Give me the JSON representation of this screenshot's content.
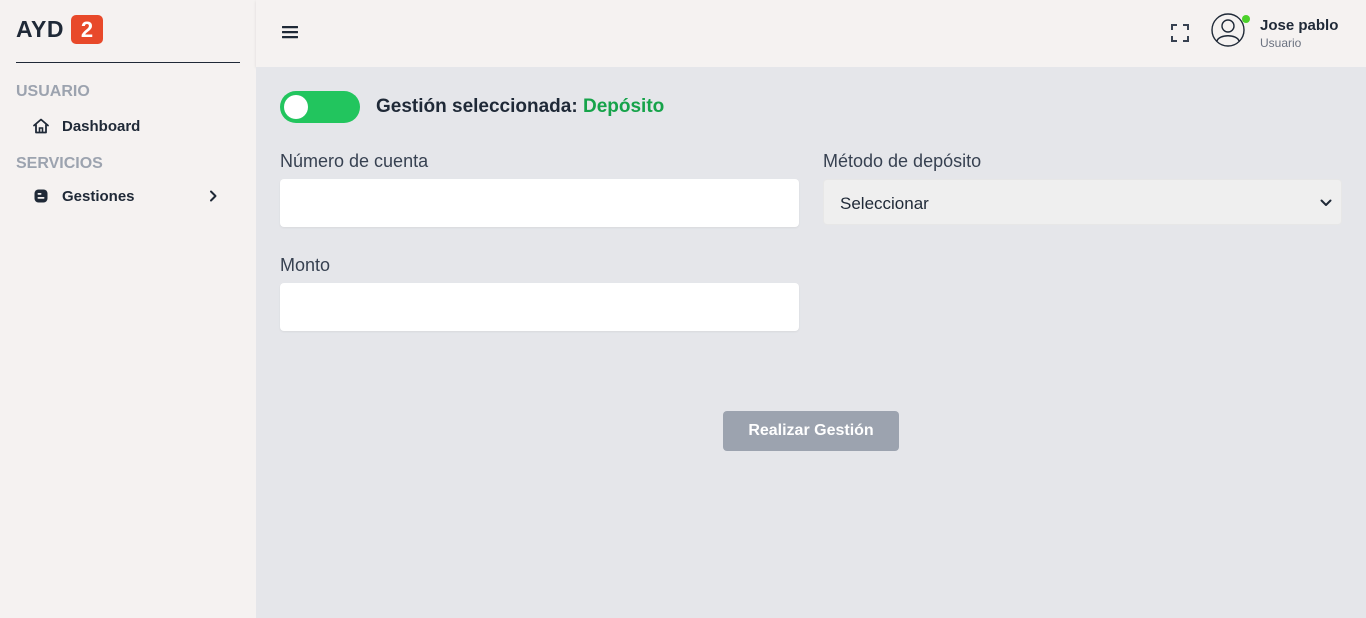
{
  "brand": {
    "text": "AYD",
    "badge": "2",
    "badge_color": "#e8492a"
  },
  "sidebar": {
    "sections": [
      {
        "title": "USUARIO",
        "items": [
          {
            "label": "Dashboard",
            "icon": "home-icon"
          }
        ]
      },
      {
        "title": "SERVICIOS",
        "items": [
          {
            "label": "Gestiones",
            "icon": "blogger-icon",
            "has_submenu": true
          }
        ]
      }
    ]
  },
  "header": {
    "menu_icon": "hamburger-icon",
    "fullscreen_icon": "fullscreen-icon",
    "user": {
      "name": "Jose pablo",
      "role": "Usuario",
      "status": "online",
      "status_color": "#4bd12a"
    }
  },
  "main": {
    "toggle": {
      "on": true,
      "color": "#22c55e"
    },
    "selected_prefix": "Gestión seleccionada:",
    "selected_value": "Depósito",
    "selected_value_color": "#16a34a",
    "fields": {
      "account": {
        "label": "Número de cuenta",
        "value": ""
      },
      "method": {
        "label": "Método de depósito",
        "selected": "Seleccionar"
      },
      "amount": {
        "label": "Monto",
        "value": ""
      }
    },
    "submit_label": "Realizar Gestión"
  }
}
